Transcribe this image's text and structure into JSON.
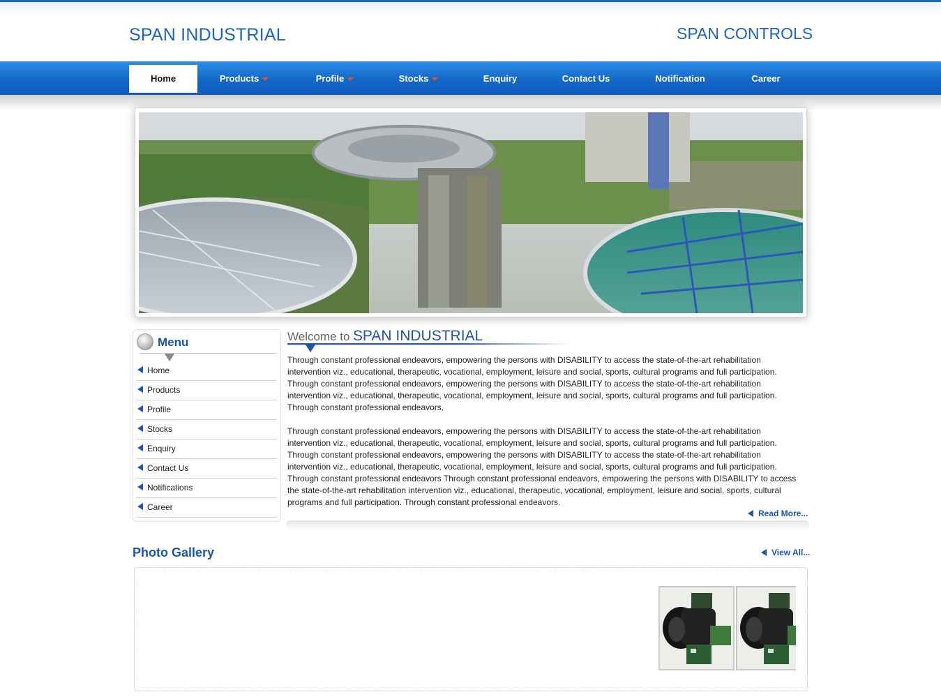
{
  "header": {
    "brand_left": "SPAN INDUSTRIAL",
    "brand_right": "SPAN CONTROLS"
  },
  "nav": {
    "items": [
      {
        "label": "Home",
        "active": true,
        "dropdown": false
      },
      {
        "label": "Products",
        "active": false,
        "dropdown": true
      },
      {
        "label": "Profile",
        "active": false,
        "dropdown": true
      },
      {
        "label": "Stocks",
        "active": false,
        "dropdown": true
      },
      {
        "label": "Enquiry",
        "active": false,
        "dropdown": false
      },
      {
        "label": "Contact Us",
        "active": false,
        "dropdown": false
      },
      {
        "label": "Notification",
        "active": false,
        "dropdown": false
      },
      {
        "label": "Career",
        "active": false,
        "dropdown": false
      }
    ]
  },
  "sidebar": {
    "title": "Menu",
    "items": [
      {
        "label": "Home"
      },
      {
        "label": "Products"
      },
      {
        "label": "Profile"
      },
      {
        "label": "Stocks"
      },
      {
        "label": "Enquiry"
      },
      {
        "label": "Contact Us"
      },
      {
        "label": "Notifications"
      },
      {
        "label": "Career"
      }
    ]
  },
  "welcome": {
    "prefix": "Welcome to",
    "name": "SPAN INDUSTRIAL",
    "paragraphs": [
      "Through constant professional endeavors, empowering the persons with DISABILITY to access the state-of-the-art rehabilitation intervention viz., educational, therapeutic, vocational, employment, leisure and social, sports, cultural programs and full participation. Through constant professional endeavors, empowering the persons with DISABILITY to access the state-of-the-art rehabilitation intervention viz., educational, therapeutic, vocational, employment, leisure and social, sports, cultural programs and full participation. Through constant professional endeavors.",
      "Through constant professional endeavors, empowering the persons with DISABILITY to access the state-of-the-art rehabilitation intervention viz., educational, therapeutic, vocational, employment, leisure and social, sports, cultural programs and full participation. Through constant professional endeavors, empowering the persons with DISABILITY to access the state-of-the-art rehabilitation intervention viz., educational, therapeutic, vocational, employment, leisure and social, sports, cultural programs and full participation. Through constant professional endeavors Through constant professional endeavors, empowering the persons with DISABILITY to access the state-of-the-art rehabilitation intervention viz., educational, therapeutic, vocational, employment, leisure and social, sports, cultural programs and full participation. Through constant professional endeavors."
    ],
    "read_more": "Read More..."
  },
  "gallery": {
    "title": "Photo Gallery",
    "view_all": "View All..."
  },
  "colors": {
    "accent": "#1b55b0",
    "nav_blue": "#1467c7",
    "brand_blue": "#1b63c6"
  }
}
